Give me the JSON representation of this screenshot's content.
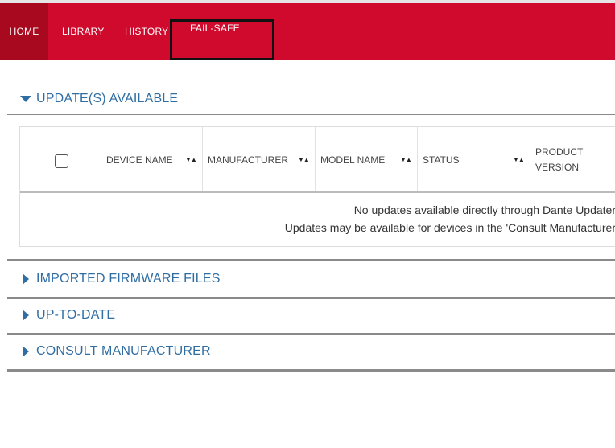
{
  "nav": {
    "home": "HOME",
    "library": "LIBRARY",
    "history": "HISTORY",
    "failsafe": "FAIL-SAFE"
  },
  "sections": {
    "updates_available": "UPDATE(S) AVAILABLE",
    "imported_firmware": "IMPORTED FIRMWARE FILES",
    "up_to_date": "UP-TO-DATE",
    "consult_manufacturer": "CONSULT MANUFACTURER"
  },
  "table": {
    "columns": [
      "DEVICE NAME",
      "MANUFACTURER",
      "MODEL NAME",
      "STATUS",
      "PRODUCT",
      "VERSION"
    ],
    "sort_glyph": "▼▲",
    "empty_line1": "No updates available directly through Dante Updater",
    "empty_line2": "Updates may be available for devices in the 'Consult Manufacturer"
  },
  "colors": {
    "navbar": "#cf0a2c",
    "nav_active": "#a8091f",
    "section_text": "#2f6da3"
  },
  "icons": {
    "expanded": "caret-down-icon",
    "collapsed": "caret-right-icon",
    "sort": "sort-icon"
  }
}
